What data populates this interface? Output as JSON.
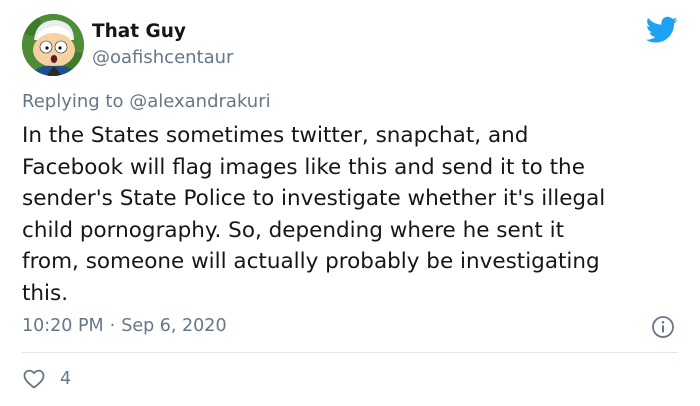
{
  "author": {
    "display_name": "That Guy",
    "handle": "@oafishcentaur",
    "avatar_icon": "cartoon-character-avatar"
  },
  "reply": {
    "prefix": "Replying to ",
    "mention": "@alexandrakuri"
  },
  "tweet": {
    "text": "In the States sometimes twitter, snapchat, and\nFacebook will flag images like this and send it to the\nsender's State Police to investigate whether it's illegal\nchild pornography. So, depending where he sent it\nfrom, someone will actually probably be investigating\nthis.",
    "time": "10:20 PM",
    "separator": "·",
    "date": "Sep 6, 2020"
  },
  "actions": {
    "like_count": "4",
    "like_icon": "heart-icon",
    "info_icon": "info-icon"
  },
  "brand": {
    "logo_icon": "twitter-bird-icon",
    "accent": "#1da1f2",
    "secondary_text": "#657786",
    "primary_text": "#14171a",
    "divider": "#e1e8ed"
  }
}
